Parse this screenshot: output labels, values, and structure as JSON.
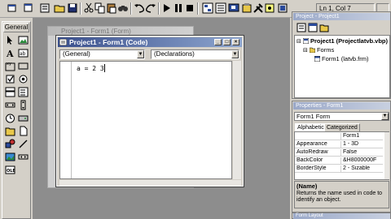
{
  "toolbar": {
    "cursor_position": "Ln 1, Col 7",
    "buttons": [
      "add-project-icon",
      "add-form-icon",
      "menu-editor-icon",
      "open-icon",
      "save-icon",
      "cut-icon",
      "copy-icon",
      "paste-icon",
      "find-icon",
      "undo-icon",
      "redo-icon",
      "run-icon",
      "break-icon",
      "end-icon",
      "project-explorer-icon",
      "properties-icon",
      "form-layout-icon",
      "object-browser-icon",
      "toolbox-icon",
      "data-view-icon",
      "component-manager-icon"
    ]
  },
  "toolbox": {
    "tab_label": "General",
    "tools": [
      "pointer-icon",
      "picturebox-icon",
      "label-icon",
      "textbox-icon",
      "frame-icon",
      "commandbutton-icon",
      "checkbox-icon",
      "optionbutton-icon",
      "combobox-icon",
      "listbox-icon",
      "hscrollbar-icon",
      "vscrollbar-icon",
      "timer-icon",
      "drivelistbox-icon",
      "dirlistbox-icon",
      "filelistbox-icon",
      "shape-icon",
      "line-icon",
      "image-icon",
      "data-icon",
      "ole-icon"
    ]
  },
  "background_window": {
    "title": "Project1 - Form1 (Form)"
  },
  "code_window": {
    "title": "Project1 - Form1 (Code)",
    "object_combo": "(General)",
    "procedure_combo": "(Declarations)",
    "code_text": "a = 2 3"
  },
  "project_explorer": {
    "title": "Project - Project1",
    "tree": {
      "project": "Project1 (Projectlatvb.vbp)",
      "folder": "Forms",
      "form": "Form1 (latvb.frm)"
    }
  },
  "properties": {
    "title": "Properties - Form1",
    "object": "Form1  Form",
    "tabs": [
      "Alphabetic",
      "Categorized"
    ],
    "rows": [
      {
        "name": "",
        "value": "Form1"
      },
      {
        "name": "Appearance",
        "value": "1 - 3D"
      },
      {
        "name": "AutoRedraw",
        "value": "False"
      },
      {
        "name": "BackColor",
        "value": "&H8000000F"
      },
      {
        "name": "BorderStyle",
        "value": "2 - Sizable"
      }
    ],
    "description_title": "(Name)",
    "description_text": "Returns the name used in code to identify an object."
  },
  "form_layout": {
    "title": "Form Layout"
  },
  "colors": {
    "active_title": "#3a4f8c",
    "inactive_title": "#9aa8c8",
    "mdi_background": "#8d8d8d",
    "face": "#d4d0c8"
  }
}
